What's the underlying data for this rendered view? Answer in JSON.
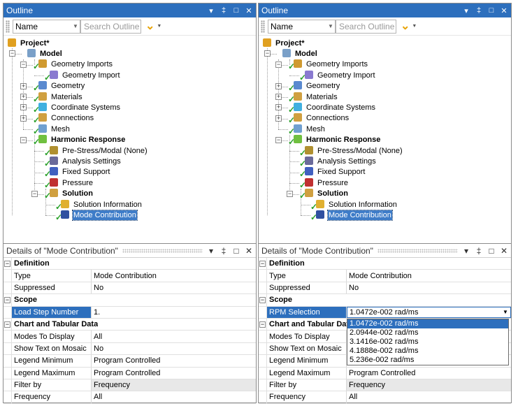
{
  "panels": [
    {
      "outline": {
        "title": "Outline",
        "controls": [
          "▾",
          "‡",
          "□",
          "✕"
        ],
        "filter_select": "Name",
        "search_placeholder": "Search Outline",
        "tree": [
          {
            "label": "Project*",
            "icon": "project-icon",
            "bold": true
          },
          {
            "label": "Model",
            "icon": "model-icon",
            "bold": true
          },
          {
            "label": "Geometry Imports",
            "icon": "geometry-imports-icon"
          },
          {
            "label": "Geometry Import",
            "icon": "geometry-import-icon"
          },
          {
            "label": "Geometry",
            "icon": "geometry-icon"
          },
          {
            "label": "Materials",
            "icon": "materials-icon"
          },
          {
            "label": "Coordinate Systems",
            "icon": "coordinate-systems-icon"
          },
          {
            "label": "Connections",
            "icon": "connections-icon"
          },
          {
            "label": "Mesh",
            "icon": "mesh-icon"
          },
          {
            "label": "Harmonic Response",
            "icon": "harmonic-response-icon",
            "bold": true
          },
          {
            "label": "Pre-Stress/Modal (None)",
            "icon": "pre-stress-icon"
          },
          {
            "label": "Analysis Settings",
            "icon": "analysis-settings-icon"
          },
          {
            "label": "Fixed Support",
            "icon": "fixed-support-icon"
          },
          {
            "label": "Pressure",
            "icon": "pressure-icon"
          },
          {
            "label": "Solution",
            "icon": "solution-icon",
            "bold": true
          },
          {
            "label": "Solution Information",
            "icon": "solution-information-icon"
          },
          {
            "label": "Mode Contribution",
            "icon": "mode-contribution-icon",
            "selected": true
          }
        ]
      },
      "details": {
        "title": "Details of \"Mode Contribution\"",
        "controls": [
          "▾",
          "‡",
          "□",
          "✕"
        ],
        "rows": [
          {
            "section": "Definition"
          },
          {
            "key": "Type",
            "value": "Mode Contribution"
          },
          {
            "key": "Suppressed",
            "value": "No"
          },
          {
            "section": "Scope"
          },
          {
            "key": "Load Step Number",
            "value": "1.",
            "highlight": true
          },
          {
            "section": "Chart and Tabular Data"
          },
          {
            "key": "Modes To Display",
            "value": "All"
          },
          {
            "key": "Show Text on Mosaic",
            "value": "No"
          },
          {
            "key": "Legend Minimum",
            "value": "Program Controlled"
          },
          {
            "key": "Legend Maximum",
            "value": "Program Controlled"
          },
          {
            "key": "Filter by",
            "value": "Frequency",
            "grey": true
          },
          {
            "key": "Frequency",
            "value": "All"
          }
        ]
      }
    },
    {
      "outline": {
        "title": "Outline",
        "controls": [
          "▾",
          "‡",
          "□",
          "✕"
        ],
        "filter_select": "Name",
        "search_placeholder": "Search Outline",
        "tree": [
          {
            "label": "Project*",
            "icon": "project-icon",
            "bold": true
          },
          {
            "label": "Model",
            "icon": "model-icon",
            "bold": true
          },
          {
            "label": "Geometry Imports",
            "icon": "geometry-imports-icon"
          },
          {
            "label": "Geometry Import",
            "icon": "geometry-import-icon"
          },
          {
            "label": "Geometry",
            "icon": "geometry-icon"
          },
          {
            "label": "Materials",
            "icon": "materials-icon"
          },
          {
            "label": "Coordinate Systems",
            "icon": "coordinate-systems-icon"
          },
          {
            "label": "Connections",
            "icon": "connections-icon"
          },
          {
            "label": "Mesh",
            "icon": "mesh-icon"
          },
          {
            "label": "Harmonic Response",
            "icon": "harmonic-response-icon",
            "bold": true
          },
          {
            "label": "Pre-Stress/Modal (None)",
            "icon": "pre-stress-icon"
          },
          {
            "label": "Analysis Settings",
            "icon": "analysis-settings-icon"
          },
          {
            "label": "Fixed Support",
            "icon": "fixed-support-icon"
          },
          {
            "label": "Pressure",
            "icon": "pressure-icon"
          },
          {
            "label": "Solution",
            "icon": "solution-icon",
            "bold": true
          },
          {
            "label": "Solution Information",
            "icon": "solution-information-icon"
          },
          {
            "label": "Mode Contribution",
            "icon": "mode-contribution-icon",
            "selected": true
          }
        ]
      },
      "details": {
        "title": "Details of \"Mode Contribution\"",
        "controls": [
          "▾",
          "‡",
          "□",
          "✕"
        ],
        "rows": [
          {
            "section": "Definition"
          },
          {
            "key": "Type",
            "value": "Mode Contribution"
          },
          {
            "key": "Suppressed",
            "value": "No"
          },
          {
            "section": "Scope"
          },
          {
            "key": "RPM Selection",
            "value": "1.0472e-002 rad/ms",
            "highlight": true,
            "dropdown": true
          },
          {
            "section": "Chart and Tabular Data"
          },
          {
            "key": "Modes To Display",
            "value": ""
          },
          {
            "key": "Show Text on Mosaic",
            "value": ""
          },
          {
            "key": "Legend Minimum",
            "value": ""
          },
          {
            "key": "Legend Maximum",
            "value": "Program Controlled"
          },
          {
            "key": "Filter by",
            "value": "Frequency",
            "grey": true
          },
          {
            "key": "Frequency",
            "value": "All"
          }
        ],
        "rpm_options": [
          "1.0472e-002 rad/ms",
          "2.0944e-002 rad/ms",
          "3.1416e-002 rad/ms",
          "4.1888e-002 rad/ms",
          "5.236e-002 rad/ms"
        ],
        "rpm_selected_index": 0
      }
    }
  ],
  "colors": {
    "titlebar": "#2d6fbd",
    "selection": "#3e7cc8",
    "check": "#2aa02a",
    "filter_chevron": "#e8a200"
  }
}
